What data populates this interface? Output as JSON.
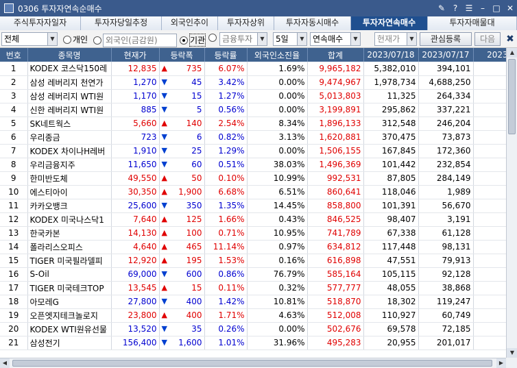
{
  "window": {
    "title": "0306 투자자연속순매수"
  },
  "tabs": [
    {
      "label": "주식투자자일자"
    },
    {
      "label": "투자자당일추정"
    },
    {
      "label": "외국인추이"
    },
    {
      "label": "투자자상위"
    },
    {
      "label": "투자자동시매수"
    },
    {
      "label": "투자자연속매수",
      "active": true
    },
    {
      "label": "투자자매물대"
    }
  ],
  "toolbar": {
    "market": "전체",
    "radio_individual": "개인",
    "radio_foreign": "외국인(금감원)",
    "radio_institution": "기관",
    "investor_select": "금융투자",
    "period_select": "5일",
    "mode_select": "연속매수",
    "price_select": "현재가",
    "watch_button": "관심등록",
    "next_button": "다음"
  },
  "table": {
    "headers": [
      "번호",
      "종목명",
      "현재가",
      "등락폭",
      "등락률",
      "외국인소진율",
      "합계",
      "2023/07/18",
      "2023/07/17",
      "2023/07"
    ],
    "rows": [
      {
        "no": "1",
        "name": "KODEX 코스닥150레",
        "price": "12,835",
        "dir": "up",
        "change": "735",
        "rate": "6.07%",
        "foreign": "1.69%",
        "total": "9,965,182",
        "d1": "5,382,010",
        "d2": "394,101",
        "d3": "2,26"
      },
      {
        "no": "2",
        "name": "삼성 레버리지 천연가",
        "price": "1,270",
        "dir": "down",
        "change": "45",
        "rate": "3.42%",
        "foreign": "0.00%",
        "total": "9,474,967",
        "d1": "1,978,734",
        "d2": "4,688,250",
        "d3": "37"
      },
      {
        "no": "3",
        "name": "삼성 레버리지 WTI원",
        "price": "1,170",
        "dir": "down",
        "change": "15",
        "rate": "1.27%",
        "foreign": "0.00%",
        "total": "5,013,803",
        "d1": "11,325",
        "d2": "264,334",
        "d3": "56"
      },
      {
        "no": "4",
        "name": "신한 레버리지 WTI원",
        "price": "885",
        "dir": "down",
        "change": "5",
        "rate": "0.56%",
        "foreign": "0.00%",
        "total": "3,199,891",
        "d1": "295,862",
        "d2": "337,221",
        "d3": "37"
      },
      {
        "no": "5",
        "name": "SK네트웍스",
        "price": "5,660",
        "dir": "up",
        "change": "140",
        "rate": "2.54%",
        "foreign": "8.34%",
        "total": "1,896,133",
        "d1": "312,548",
        "d2": "246,204",
        "d3": "40"
      },
      {
        "no": "6",
        "name": "우리종금",
        "price": "723",
        "dir": "down",
        "change": "6",
        "rate": "0.82%",
        "foreign": "3.13%",
        "total": "1,620,881",
        "d1": "370,475",
        "d2": "73,873",
        "d3": "87"
      },
      {
        "no": "7",
        "name": "KODEX 차이나H레버",
        "price": "1,910",
        "dir": "down",
        "change": "25",
        "rate": "1.29%",
        "foreign": "0.00%",
        "total": "1,506,155",
        "d1": "167,845",
        "d2": "172,360",
        "d3": "13"
      },
      {
        "no": "8",
        "name": "우리금융지주",
        "price": "11,650",
        "dir": "down",
        "change": "60",
        "rate": "0.51%",
        "foreign": "38.03%",
        "total": "1,496,369",
        "d1": "101,442",
        "d2": "232,854",
        "d3": "40"
      },
      {
        "no": "9",
        "name": "한미반도체",
        "price": "49,550",
        "dir": "up",
        "change": "50",
        "rate": "0.10%",
        "foreign": "10.99%",
        "total": "992,531",
        "d1": "87,805",
        "d2": "284,149",
        "d3": "19"
      },
      {
        "no": "10",
        "name": "에스티아이",
        "price": "30,350",
        "dir": "up",
        "change": "1,900",
        "rate": "6.68%",
        "foreign": "6.51%",
        "total": "860,641",
        "d1": "118,046",
        "d2": "1,989",
        "d3": "23"
      },
      {
        "no": "11",
        "name": "카카오뱅크",
        "price": "25,600",
        "dir": "down",
        "change": "350",
        "rate": "1.35%",
        "foreign": "14.45%",
        "total": "858,800",
        "d1": "101,391",
        "d2": "56,670",
        "d3": "14"
      },
      {
        "no": "12",
        "name": "KODEX 미국나스닥1",
        "price": "7,640",
        "dir": "up",
        "change": "125",
        "rate": "1.66%",
        "foreign": "0.43%",
        "total": "846,525",
        "d1": "98,407",
        "d2": "3,191",
        "d3": "20"
      },
      {
        "no": "13",
        "name": "한국카본",
        "price": "14,130",
        "dir": "up",
        "change": "100",
        "rate": "0.71%",
        "foreign": "10.95%",
        "total": "741,789",
        "d1": "67,338",
        "d2": "61,128",
        "d3": "16"
      },
      {
        "no": "14",
        "name": "폴라리스오피스",
        "price": "4,640",
        "dir": "up",
        "change": "465",
        "rate": "11.14%",
        "foreign": "0.97%",
        "total": "634,812",
        "d1": "117,448",
        "d2": "98,131",
        "d3": "1"
      },
      {
        "no": "15",
        "name": "TIGER 미국필라델피",
        "price": "12,920",
        "dir": "up",
        "change": "195",
        "rate": "1.53%",
        "foreign": "0.16%",
        "total": "616,898",
        "d1": "47,551",
        "d2": "79,913",
        "d3": "3"
      },
      {
        "no": "16",
        "name": "S-Oil",
        "price": "69,000",
        "dir": "down",
        "change": "600",
        "rate": "0.86%",
        "foreign": "76.79%",
        "total": "585,164",
        "d1": "105,115",
        "d2": "92,128",
        "d3": "14"
      },
      {
        "no": "17",
        "name": "TIGER 미국테크TOP",
        "price": "13,545",
        "dir": "up",
        "change": "15",
        "rate": "0.11%",
        "foreign": "0.32%",
        "total": "577,777",
        "d1": "48,055",
        "d2": "38,868",
        "d3": "5"
      },
      {
        "no": "18",
        "name": "아모레G",
        "price": "27,800",
        "dir": "down",
        "change": "400",
        "rate": "1.42%",
        "foreign": "10.81%",
        "total": "518,870",
        "d1": "18,302",
        "d2": "119,247",
        "d3": "8"
      },
      {
        "no": "19",
        "name": "오픈엣지테크놀로지",
        "price": "23,800",
        "dir": "up",
        "change": "400",
        "rate": "1.71%",
        "foreign": "4.63%",
        "total": "512,008",
        "d1": "110,927",
        "d2": "60,749",
        "d3": ""
      },
      {
        "no": "20",
        "name": "KODEX WTI원유선물",
        "price": "13,520",
        "dir": "down",
        "change": "35",
        "rate": "0.26%",
        "foreign": "0.00%",
        "total": "502,676",
        "d1": "69,578",
        "d2": "72,185",
        "d3": "13"
      },
      {
        "no": "21",
        "name": "삼성전기",
        "price": "156,400",
        "dir": "down",
        "change": "1,600",
        "rate": "1.01%",
        "foreign": "31.96%",
        "total": "495,283",
        "d1": "20,955",
        "d2": "201,017",
        "d3": "10"
      }
    ]
  }
}
